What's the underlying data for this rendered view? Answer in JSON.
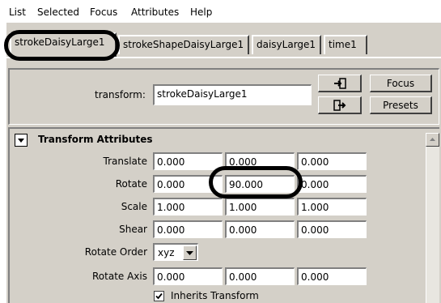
{
  "menu": [
    "List",
    "Selected",
    "Focus",
    "Attributes",
    "Help"
  ],
  "tabs": [
    "strokeDaisyLarge1",
    "strokeShapeDaisyLarge1",
    "daisyLarge1",
    "time1"
  ],
  "transform": {
    "label": "transform:",
    "value": "strokeDaisyLarge1",
    "focus_label": "Focus",
    "presets_label": "Presets",
    "icons": [
      "input-connections-icon",
      "output-connections-icon"
    ]
  },
  "section": {
    "title": "Transform Attributes",
    "toggle_icon": "collapse-triangle-icon"
  },
  "attributes": [
    {
      "label": "Translate",
      "values": [
        "0.000",
        "0.000",
        "0.000"
      ]
    },
    {
      "label": "Rotate",
      "values": [
        "0.000",
        "90.000",
        "0.000"
      ]
    },
    {
      "label": "Scale",
      "values": [
        "1.000",
        "1.000",
        "1.000"
      ]
    },
    {
      "label": "Shear",
      "values": [
        "0.000",
        "0.000",
        "0.000"
      ]
    }
  ],
  "rotate_order": {
    "label": "Rotate Order",
    "value": "xyz"
  },
  "rotate_axis": {
    "label": "Rotate Axis",
    "values": [
      "0.000",
      "0.000",
      "0.000"
    ]
  },
  "inherits": {
    "label": "Inherits Transform",
    "checked": true
  },
  "highlight_color": "#000000",
  "panel_color": "#d4d0c8"
}
